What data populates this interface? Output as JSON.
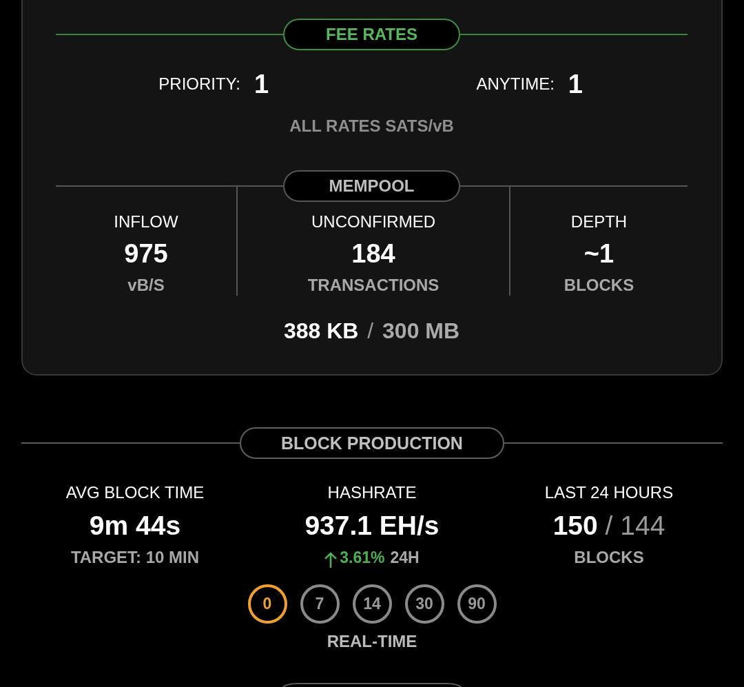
{
  "fee_rates": {
    "title": "FEE RATES",
    "rates": [
      {
        "label": "PRIORITY:",
        "value": "1"
      },
      {
        "label": "ANYTIME:",
        "value": "1"
      }
    ],
    "note": "ALL RATES SATS/vB"
  },
  "mempool": {
    "title": "MEMPOOL",
    "stats": [
      {
        "label": "INFLOW",
        "value": "975",
        "unit": "vB/S"
      },
      {
        "label": "UNCONFIRMED",
        "value": "184",
        "unit": "TRANSACTIONS"
      },
      {
        "label": "DEPTH",
        "value": "~1",
        "unit": "BLOCKS"
      }
    ],
    "size": {
      "used": "388 KB",
      "separator": "/",
      "limit": "300 MB"
    }
  },
  "block_production": {
    "title": "BLOCK PRODUCTION",
    "stats": [
      {
        "kind": "time",
        "label": "AVG BLOCK TIME",
        "value": "9m 44s",
        "sub": "TARGET: 10 MIN"
      },
      {
        "kind": "change",
        "label": "HASHRATE",
        "value": "937.1 EH/s",
        "rising": true,
        "change": "3.61%",
        "period": "24H"
      },
      {
        "kind": "ratio",
        "label": "LAST 24 HOURS",
        "value": "150",
        "separator": "/",
        "total": "144",
        "sub": "BLOCKS"
      }
    ],
    "range_buttons": [
      {
        "label": "0",
        "selected": true
      },
      {
        "label": "7",
        "selected": false
      },
      {
        "label": "14",
        "selected": false
      },
      {
        "label": "30",
        "selected": false
      },
      {
        "label": "90",
        "selected": false
      }
    ],
    "range_caption": "REAL-TIME"
  }
}
